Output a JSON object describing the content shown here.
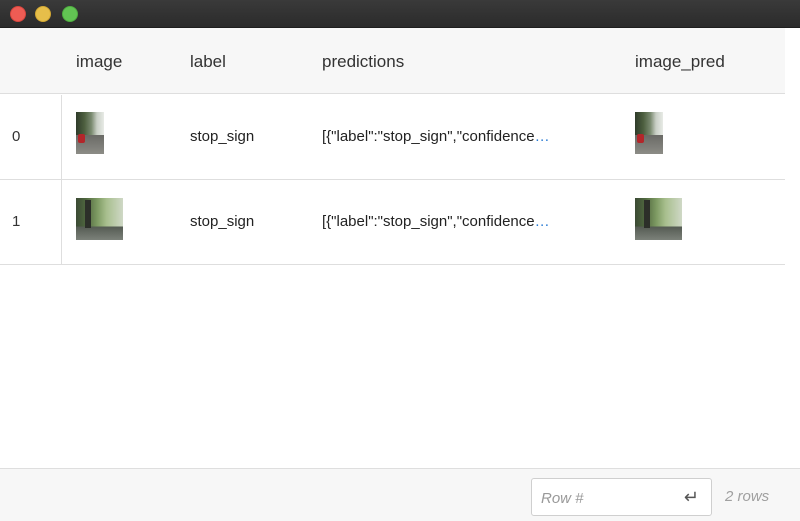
{
  "window": {
    "traffic_lights": [
      "close",
      "minimize",
      "zoom"
    ],
    "colors": {
      "close": "#ee5c54",
      "minimize": "#e6be4a",
      "zoom": "#62c453"
    }
  },
  "table": {
    "columns": [
      "image",
      "label",
      "predictions",
      "image_pred"
    ],
    "rows": [
      {
        "index": "0",
        "image": "stop-sign-street-thumbnail",
        "label": "stop_sign",
        "predictions": "[{\"label\":\"stop_sign\",\"confidence",
        "image_pred": "stop-sign-street-thumbnail"
      },
      {
        "index": "1",
        "image": "tree-street-thumbnail",
        "label": "stop_sign",
        "predictions": "[{\"label\":\"stop_sign\",\"confidence",
        "image_pred": "tree-street-thumbnail"
      }
    ],
    "truncation": "…",
    "link_color": "#2a7bd4"
  },
  "footer": {
    "row_input": {
      "placeholder": "Row #",
      "value": ""
    },
    "enter_glyph": "↵",
    "row_count": "2 rows"
  }
}
